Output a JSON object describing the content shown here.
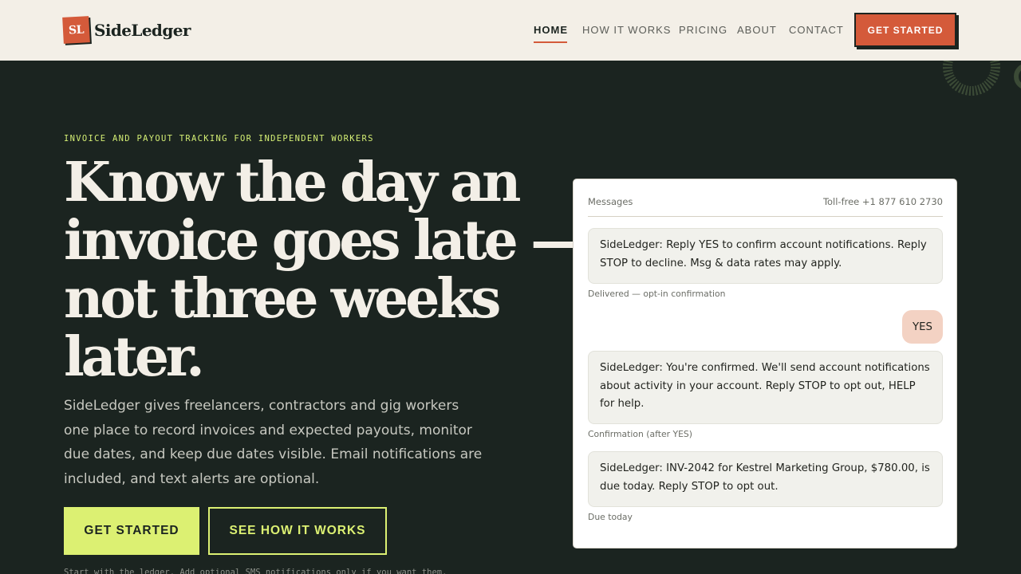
{
  "brand": {
    "mark": "SL",
    "name": "SideLedger",
    "accent": "#d45a3a",
    "highlight": "#dcf072",
    "background": "#1b2420"
  },
  "nav": {
    "items": [
      "HOME",
      "HOW IT WORKS",
      "PRICING",
      "ABOUT",
      "CONTACT"
    ],
    "active": "HOME",
    "cta": "GET STARTED"
  },
  "hero": {
    "eyebrow": "INVOICE AND PAYOUT TRACKING FOR INDEPENDENT WORKERS",
    "headline_lines": [
      "Know the day an",
      "invoice goes late —",
      "not three weeks",
      "later."
    ],
    "lede": "SideLedger gives freelancers, contractors and gig workers one place to record invoices and expected payouts, monitor due dates, and keep due dates visible. Email notifications are included, and text alerts are optional.",
    "primary_cta": "GET STARTED",
    "secondary_cta": "SEE HOW IT WORKS",
    "footnote": "Start with the ledger. Add optional SMS notifications only if you want them."
  },
  "messages": {
    "title": "Messages",
    "phone": "Toll-free +1 877 610 2730",
    "items": [
      {
        "from": "SideLedger",
        "text": "SideLedger: Reply YES to confirm account notifications. Reply STOP to decline. Msg & data rates may apply.",
        "caption": "Delivered — opt-in confirmation"
      },
      {
        "from": "user",
        "text": "YES"
      },
      {
        "from": "SideLedger",
        "text": "SideLedger: You're confirmed. We'll send account notifications about activity in your account. Reply STOP to opt out, HELP for help.",
        "caption": "Confirmation (after YES)"
      },
      {
        "from": "SideLedger",
        "text": "SideLedger: INV-2042 for Kestrel Marketing Group, $780.00, is due today. Reply STOP to opt out.",
        "caption": "Due today"
      }
    ]
  }
}
